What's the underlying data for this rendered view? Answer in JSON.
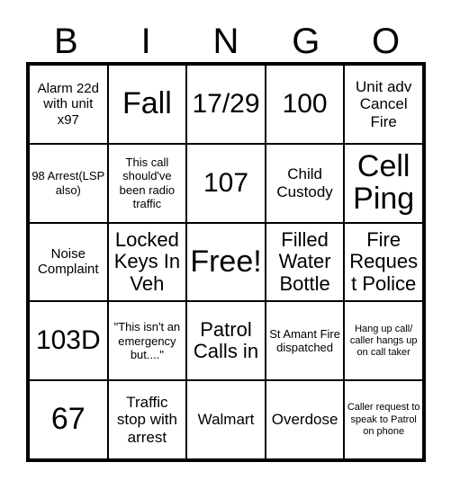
{
  "card": {
    "header": {
      "letters": [
        "B",
        "I",
        "N",
        "G",
        "O"
      ]
    },
    "colors": {
      "border": "#000000",
      "background": "#ffffff",
      "text": "#000000"
    },
    "grid": {
      "rows": 5,
      "columns": 5,
      "free_space": {
        "row": 2,
        "column": 2,
        "label": "Free!"
      },
      "cells": [
        [
          {
            "text": "Alarm 22d with unit x97",
            "size": "sm"
          },
          {
            "text": "Fall",
            "size": "xxl"
          },
          {
            "text": "17/29",
            "size": "xl"
          },
          {
            "text": "100",
            "size": "xl"
          },
          {
            "text": "Unit adv Cancel Fire",
            "size": "md"
          }
        ],
        [
          {
            "text": "98 Arrest(LSP also)",
            "size": "xs"
          },
          {
            "text": "This call should've been radio traffic",
            "size": "xs"
          },
          {
            "text": "107",
            "size": "xl"
          },
          {
            "text": "Child Custody",
            "size": "md"
          },
          {
            "text": "Cell Ping",
            "size": "xxl"
          }
        ],
        [
          {
            "text": "Noise Complaint",
            "size": "sm"
          },
          {
            "text": "Locked Keys In Veh",
            "size": "lg"
          },
          {
            "text": "Free!",
            "size": "xxl"
          },
          {
            "text": "Filled Water Bottle",
            "size": "lg"
          },
          {
            "text": "Fire Request Police",
            "size": "lg"
          }
        ],
        [
          {
            "text": "103D",
            "size": "xl"
          },
          {
            "text": "\"This isn't an emergency but....\"",
            "size": "xs"
          },
          {
            "text": "Patrol Calls in",
            "size": "lg"
          },
          {
            "text": "St Amant Fire dispatched",
            "size": "xs"
          },
          {
            "text": "Hang up call/ caller hangs up on call taker",
            "size": "xxs"
          }
        ],
        [
          {
            "text": "67",
            "size": "xxl"
          },
          {
            "text": "Traffic stop with arrest",
            "size": "md"
          },
          {
            "text": "Walmart",
            "size": "md"
          },
          {
            "text": "Overdose",
            "size": "md"
          },
          {
            "text": "Caller request to speak to Patrol on phone",
            "size": "xxs"
          }
        ]
      ]
    }
  }
}
